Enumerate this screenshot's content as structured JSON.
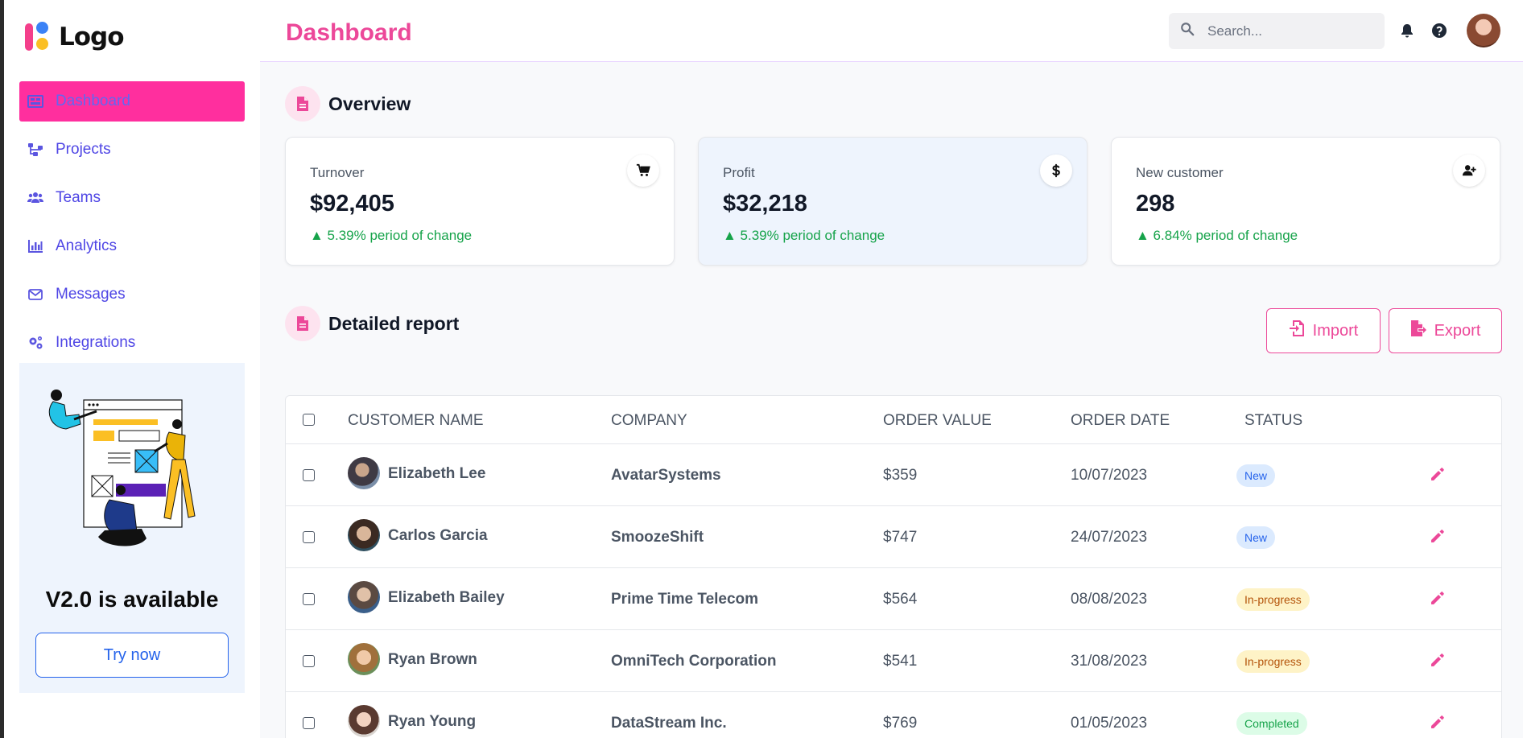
{
  "brand": {
    "logo_text": "Logo"
  },
  "sidebar": {
    "items": [
      {
        "label": "Dashboard",
        "icon": "dashboard-icon",
        "active": true
      },
      {
        "label": "Projects",
        "icon": "sitemap-icon"
      },
      {
        "label": "Teams",
        "icon": "users-icon"
      },
      {
        "label": "Analytics",
        "icon": "bar-chart-icon"
      },
      {
        "label": "Messages",
        "icon": "envelope-icon"
      },
      {
        "label": "Integrations",
        "icon": "cogs-icon"
      }
    ],
    "promo": {
      "title": "V2.0 is available",
      "button": "Try now"
    }
  },
  "header": {
    "title": "Dashboard",
    "search_placeholder": "Search...",
    "icons": [
      "bell-icon",
      "help-icon",
      "user-avatar"
    ]
  },
  "overview": {
    "title": "Overview",
    "cards": [
      {
        "title": "Turnover",
        "value": "$92,405",
        "change": "▲ 5.39% period of change",
        "icon": "cart-icon"
      },
      {
        "title": "Profit",
        "value": "$32,218",
        "change": "▲ 5.39% period of change",
        "icon": "dollar-icon"
      },
      {
        "title": "New customer",
        "value": "298",
        "change": "▲ 6.84% period of change",
        "icon": "user-plus-icon"
      }
    ]
  },
  "report": {
    "title": "Detailed report",
    "import_label": "Import",
    "export_label": "Export",
    "columns": [
      "CUSTOMER NAME",
      "COMPANY",
      "ORDER VALUE",
      "ORDER DATE",
      "STATUS"
    ],
    "rows": [
      {
        "name": "Elizabeth Lee",
        "company": "AvatarSystems",
        "value": "$359",
        "date": "10/07/2023",
        "status": "New"
      },
      {
        "name": "Carlos Garcia",
        "company": "SmoozeShift",
        "value": "$747",
        "date": "24/07/2023",
        "status": "New"
      },
      {
        "name": "Elizabeth Bailey",
        "company": "Prime Time Telecom",
        "value": "$564",
        "date": "08/08/2023",
        "status": "In-progress"
      },
      {
        "name": "Ryan Brown",
        "company": "OmniTech Corporation",
        "value": "$541",
        "date": "31/08/2023",
        "status": "In-progress"
      },
      {
        "name": "Ryan Young",
        "company": "DataStream Inc.",
        "value": "$769",
        "date": "01/05/2023",
        "status": "Completed"
      }
    ]
  },
  "colors": {
    "accent": "#ec4899",
    "nav_text": "#4f46e5",
    "active_nav_bg": "#ff2f9e",
    "positive": "#16a34a",
    "link_blue": "#2563eb"
  }
}
